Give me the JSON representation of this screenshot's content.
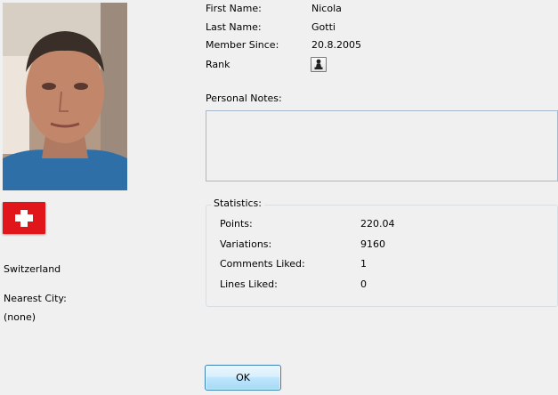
{
  "profile": {
    "first_name_label": "First Name:",
    "first_name": "Nicola",
    "last_name_label": "Last Name:",
    "last_name": "Gotti",
    "member_since_label": "Member Since:",
    "member_since": "20.8.2005",
    "rank_label": "Rank",
    "rank_icon": "chess-pawn-icon"
  },
  "location": {
    "country": "Switzerland",
    "flag_colors": {
      "field": "#e0161b",
      "cross": "#ffffff"
    },
    "nearest_city_label": "Nearest City:",
    "nearest_city": "(none)"
  },
  "notes": {
    "label": "Personal Notes:",
    "value": ""
  },
  "statistics": {
    "title": "Statistics:",
    "rows": [
      {
        "label": "Points:",
        "value": "220.04"
      },
      {
        "label": "Variations:",
        "value": "9160"
      },
      {
        "label": "Comments Liked:",
        "value": "1"
      },
      {
        "label": "Lines Liked:",
        "value": "0"
      }
    ]
  },
  "actions": {
    "ok_label": "OK"
  },
  "colors": {
    "window_bg": "#f0f0f0",
    "ok_button_border": "#3c7fb1"
  }
}
